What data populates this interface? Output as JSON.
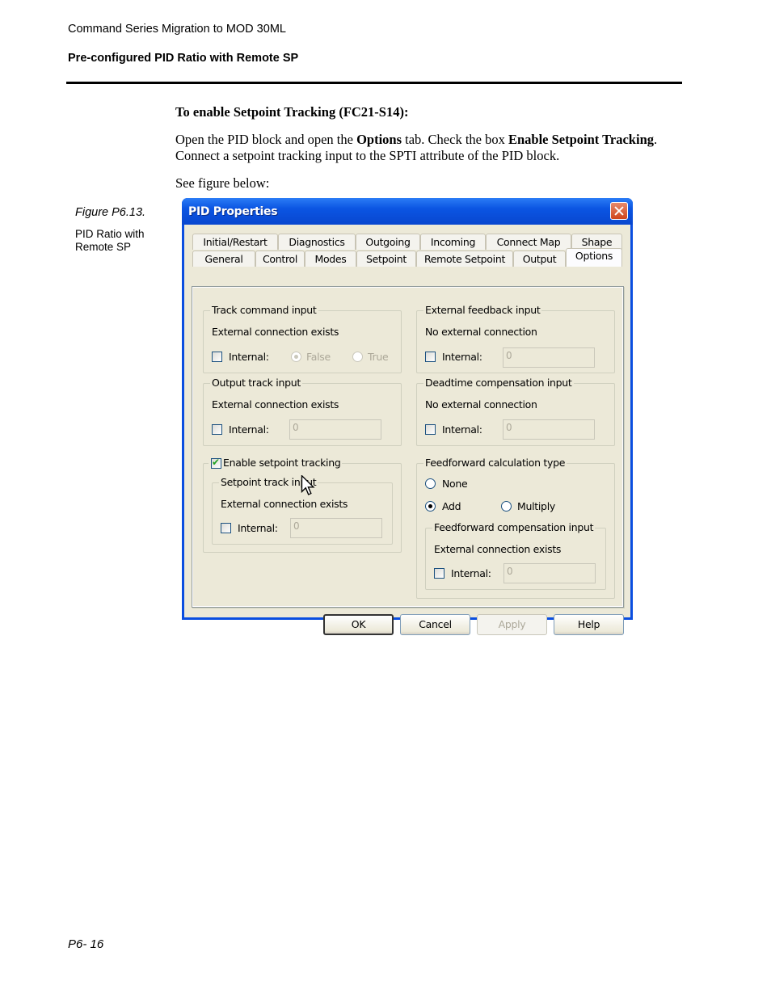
{
  "page": {
    "header_title": "Command Series Migration to MOD 30ML",
    "section_title": "Pre-configured PID Ratio with Remote SP",
    "page_number": "P6- 16"
  },
  "content": {
    "heading": "To enable Setpoint Tracking (FC21-S14):",
    "para_part1": "Open the PID block and open the ",
    "para_bold1": "Options",
    "para_part2": " tab. Check the box ",
    "para_bold2": "Enable Setpoint Tracking",
    "para_part3": ". Connect a setpoint tracking input to the SPTI attribute of the PID block.",
    "see_figure": "See figure below:"
  },
  "figure": {
    "label": "Figure P6.13.",
    "caption": "PID Ratio with Remote SP"
  },
  "dialog": {
    "title": "PID Properties",
    "tabs_row1": [
      "Initial/Restart",
      "Diagnostics",
      "Outgoing",
      "Incoming",
      "Connect Map",
      "Shape"
    ],
    "tabs_row2": [
      "General",
      "Control",
      "Modes",
      "Setpoint",
      "Remote Setpoint",
      "Output",
      "Options"
    ],
    "active_tab": "Options",
    "groups": {
      "track_command": {
        "title": "Track command input",
        "status": "External connection exists",
        "internal_label": "Internal:",
        "internal_checked": false,
        "radio_false": "False",
        "radio_true": "True",
        "selected": "False"
      },
      "external_feedback": {
        "title": "External feedback input",
        "status": "No external connection",
        "internal_label": "Internal:",
        "internal_checked": false,
        "value": "0"
      },
      "output_track": {
        "title": "Output track input",
        "status": "External connection exists",
        "internal_label": "Internal:",
        "internal_checked": false,
        "value": "0"
      },
      "deadtime_comp": {
        "title": "Deadtime compensation input",
        "status": "No external connection",
        "internal_label": "Internal:",
        "internal_checked": false,
        "value": "0"
      },
      "setpoint_tracking": {
        "enable_label": "Enable setpoint tracking",
        "enable_checked": true,
        "sub_title": "Setpoint track input",
        "status": "External connection exists",
        "internal_label": "Internal:",
        "internal_checked": false,
        "value": "0"
      },
      "feedforward": {
        "title": "Feedforward calculation type",
        "options": [
          "None",
          "Add",
          "Multiply"
        ],
        "selected": "Add",
        "comp_title": "Feedforward compensation input",
        "status": "External connection exists",
        "internal_label": "Internal:",
        "internal_checked": false,
        "value": "0"
      }
    },
    "buttons": {
      "ok": "OK",
      "cancel": "Cancel",
      "apply": "Apply",
      "help": "Help"
    }
  }
}
